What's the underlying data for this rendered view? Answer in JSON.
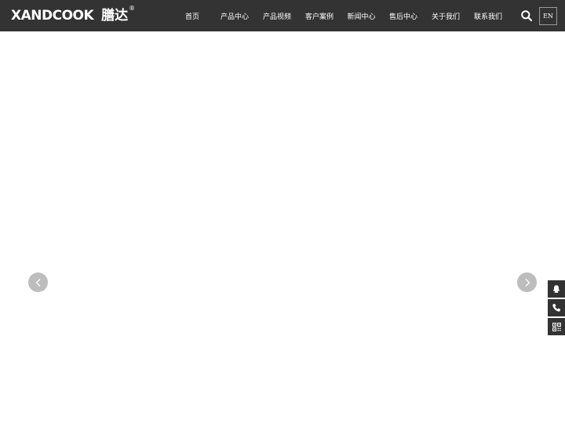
{
  "header": {
    "logo_en": "XANDCOOK",
    "logo_cn": "膳达",
    "logo_reg": "®",
    "bg_color": "#333333"
  },
  "nav": {
    "items": [
      {
        "label": "首页"
      },
      {
        "label": "产品中心"
      },
      {
        "label": "产品视频"
      },
      {
        "label": "客户案例"
      },
      {
        "label": "新闻中心"
      },
      {
        "label": "售后中心"
      },
      {
        "label": "关于我们"
      },
      {
        "label": "联系我们"
      }
    ]
  },
  "tools": {
    "search_icon": "search-icon",
    "lang_label": "EN"
  },
  "carousel": {
    "prev_icon": "chevron-left-icon",
    "next_icon": "chevron-right-icon",
    "arrow_color": "#bdbdbd"
  },
  "float_bar": {
    "items": [
      {
        "icon": "qq-icon"
      },
      {
        "icon": "phone-icon"
      },
      {
        "icon": "qrcode-icon"
      }
    ]
  }
}
